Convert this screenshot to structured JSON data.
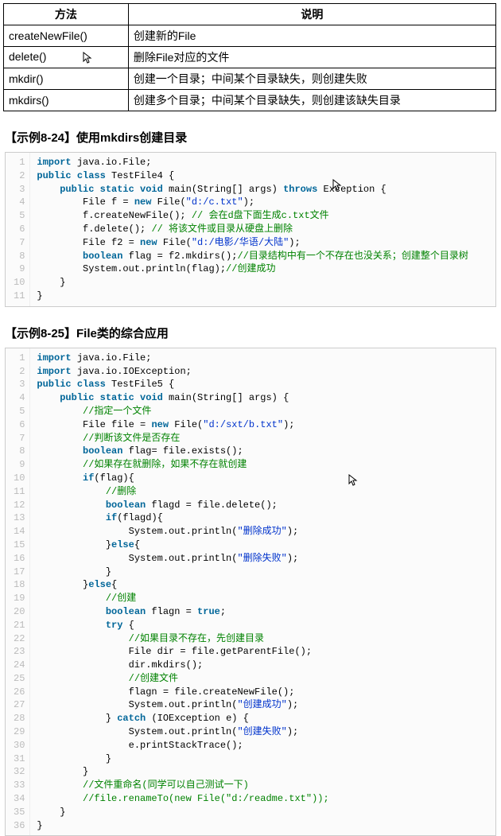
{
  "table": {
    "headers": [
      "方法",
      "说明"
    ],
    "rows": [
      [
        "createNewFile()",
        "创建新的File"
      ],
      [
        "delete()",
        "删除File对应的文件"
      ],
      [
        "mkdir()",
        "创建一个目录；中间某个目录缺失，则创建失败"
      ],
      [
        "mkdirs()",
        "创建多个目录；中间某个目录缺失，则创建该缺失目录"
      ]
    ]
  },
  "heading1": "【示例8-24】使用mkdirs创建目录",
  "code1_lines": [
    "1",
    "2",
    "3",
    "4",
    "5",
    "6",
    "7",
    "8",
    "9",
    "10",
    "11"
  ],
  "code1": {
    "l1_import": "import",
    "l1_rest": " java.io.File;",
    "l2": "public class ",
    "l2b": "TestFile4 {",
    "l3a": "    public static void ",
    "l3b": "main(String[] args) ",
    "l3c": "throws",
    "l3d": " Exception {",
    "l4a": "        File f = ",
    "l4b": "new",
    "l4c": " File(",
    "l4d": "\"d:/c.txt\"",
    "l4e": ");",
    "l5a": "        f.createNewFile(); ",
    "l5b": "// 会在d盘下面生成c.txt文件",
    "l6a": "        f.delete(); ",
    "l6b": "// 将该文件或目录从硬盘上删除",
    "l7a": "        File f2 = ",
    "l7b": "new",
    "l7c": " File(",
    "l7d": "\"d:/电影/华语/大陆\"",
    "l7e": ");",
    "l8a": "        boolean",
    "l8b": " flag = f2.mkdirs();",
    "l8c": "//目录结构中有一个不存在也没关系；创建整个目录树",
    "l9a": "        System.out.println(flag);",
    "l9b": "//创建成功",
    "l10": "    }",
    "l11": "}"
  },
  "heading2": "【示例8-25】File类的综合应用",
  "code2_lines": [
    "1",
    "2",
    "3",
    "4",
    "5",
    "6",
    "7",
    "8",
    "9",
    "10",
    "11",
    "12",
    "13",
    "14",
    "15",
    "16",
    "17",
    "18",
    "19",
    "20",
    "21",
    "22",
    "23",
    "24",
    "25",
    "26",
    "27",
    "28",
    "29",
    "30",
    "31",
    "32",
    "33",
    "34",
    "35",
    "36"
  ],
  "code2": {
    "imp": "import",
    "l1": " java.io.File;",
    "l2": " java.io.IOException;",
    "pc": "public class ",
    "l3": "TestFile5 {",
    "psv": "    public static void ",
    "l4": "main(String[] args) {",
    "c5": "        //指定一个文件",
    "l6a": "        File file = ",
    "new": "new",
    "l6b": " File(",
    "s6": "\"d:/sxt/b.txt\"",
    "l6c": ");",
    "c7": "        //判断该文件是否存在",
    "l8a": "        boolean",
    "l8b": " flag= file.exists();",
    "c9": "        //如果存在就删除，如果不存在就创建",
    "l10a": "        if",
    "l10b": "(flag){",
    "c11": "            //删除",
    "l12a": "            boolean",
    "l12b": " flagd = file.delete();",
    "l13a": "            if",
    "l13b": "(flagd){",
    "l14a": "                System.out.println(",
    "s14": "\"删除成功\"",
    "l14b": ");",
    "l15a": "            }",
    "l15b": "else",
    "l15c": "{",
    "l16a": "                System.out.println(",
    "s16": "\"删除失败\"",
    "l16b": ");",
    "l17": "            }",
    "l18": "        }",
    "l18b": "else",
    "l18c": "{",
    "c19": "            //创建",
    "l20a": "            boolean",
    "l20b": " flagn = ",
    "l20c": "true",
    "l20d": ";",
    "l21a": "            try",
    "l21b": " {",
    "c22": "                //如果目录不存在，先创建目录",
    "l23": "                File dir = file.getParentFile();",
    "l24": "                dir.mkdirs();",
    "c25": "                //创建文件",
    "l26": "                flagn = file.createNewFile();",
    "l27a": "                System.out.println(",
    "s27": "\"创建成功\"",
    "l27b": ");",
    "l28a": "            } ",
    "l28b": "catch",
    "l28c": " (IOException e) {",
    "l29a": "                System.out.println(",
    "s29": "\"创建失败\"",
    "l29b": ");",
    "l30": "                e.printStackTrace();",
    "l31": "            }",
    "l32": "        }",
    "c33": "        //文件重命名(同学可以自己测试一下)",
    "c34": "        //file.renameTo(new File(\"d:/readme.txt\"));",
    "l35": "    }",
    "l36": "}"
  }
}
